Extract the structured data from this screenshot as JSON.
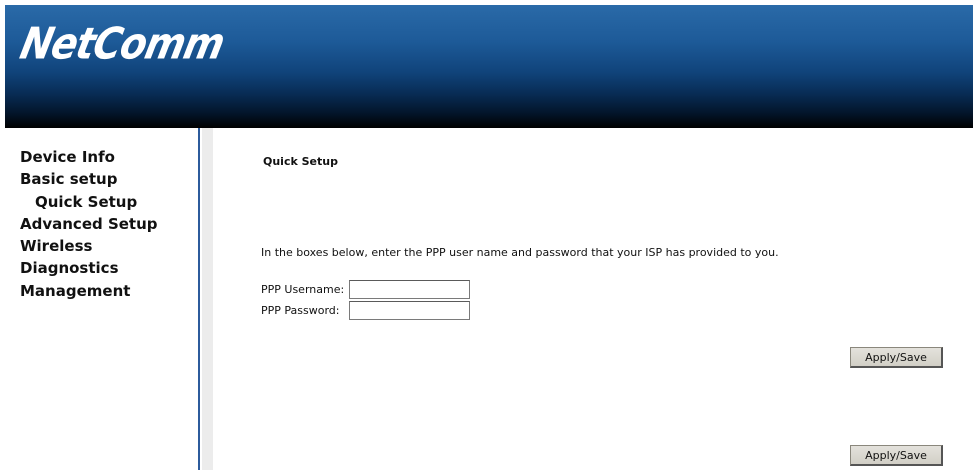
{
  "header": {
    "logo_text": "NetComm"
  },
  "sidebar": {
    "items": [
      {
        "label": "Device Info"
      },
      {
        "label": "Basic setup"
      },
      {
        "label": "Quick Setup"
      },
      {
        "label": "Advanced Setup"
      },
      {
        "label": "Wireless"
      },
      {
        "label": "Diagnostics"
      },
      {
        "label": "Management"
      }
    ]
  },
  "main": {
    "title": "Quick Setup",
    "instruction": "In the boxes below, enter the PPP user name and password that your ISP has provided to you.",
    "fields": {
      "username_label": "PPP Username:",
      "username_value": "",
      "password_label": "PPP Password:",
      "password_value": ""
    },
    "apply_label": "Apply/Save"
  }
}
